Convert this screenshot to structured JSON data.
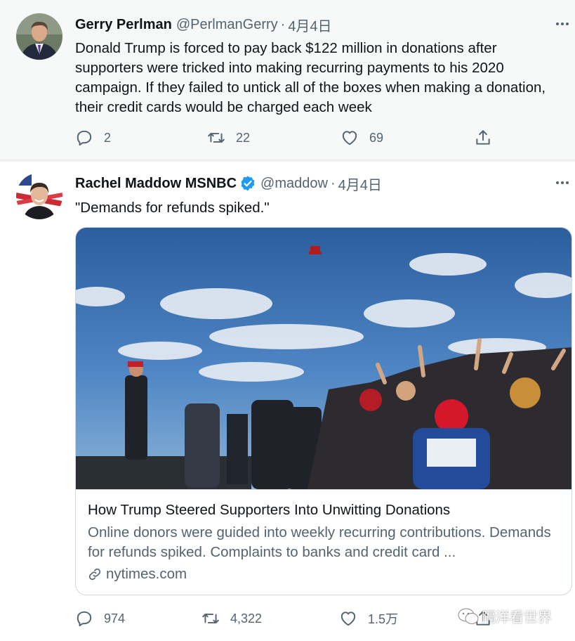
{
  "tweets": [
    {
      "display_name": "Gerry Perlman",
      "handle": "@PerlmanGerry",
      "dot": "·",
      "date": "4月4日",
      "verified": false,
      "text": "Donald Trump is forced to pay back $122 million in donations after supporters were tricked into making recurring payments to his 2020 campaign. If they failed to untick all of the boxes when making a donation, their credit cards would be charged each week",
      "actions": {
        "replies": "2",
        "retweets": "22",
        "likes": "69"
      }
    },
    {
      "display_name": "Rachel Maddow MSNBC",
      "handle": "@maddow",
      "dot": "·",
      "date": "4月4日",
      "verified": true,
      "text": "\"Demands for refunds spiked.\"",
      "card": {
        "title": "How Trump Steered Supporters Into Unwitting Donations",
        "description": "Online donors were guided into weekly recurring contributions. Demands for refunds spiked. Complaints to banks and credit card ...",
        "source": "nytimes.com"
      },
      "actions": {
        "replies": "974",
        "retweets": "4,322",
        "likes": "1.5万"
      }
    }
  ],
  "watermark": "隔洋看世界",
  "icons": {
    "more": "more-horizontal-icon",
    "reply": "reply-icon",
    "retweet": "retweet-icon",
    "like": "heart-icon",
    "share": "share-icon",
    "verified": "verified-badge-icon",
    "link": "link-icon"
  },
  "colors": {
    "text_primary": "#0f1419",
    "text_secondary": "#536471",
    "verified_blue": "#1d9bf0",
    "border": "#cfd9de",
    "tweet_highlight_bg": "#f7f9f9"
  }
}
